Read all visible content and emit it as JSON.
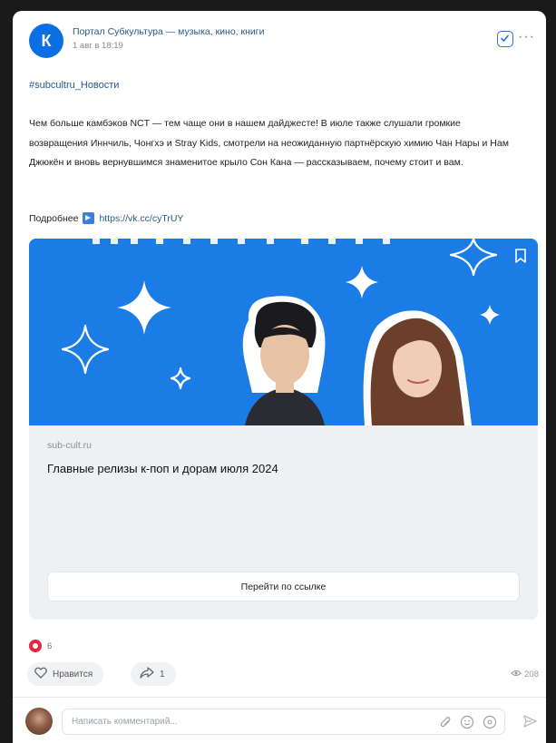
{
  "post": {
    "group_avatar_letter": "К",
    "group_name": "Портал Субкультура — музыка, кино, книги",
    "date": "1 авг в 18:19",
    "hashtag": "#subcultru_Новости",
    "text": "Чем больше камбэков NCT — тем чаще они в нашем дайджесте! В июле также слушали громкие возвращения Иннчиль, Чонгхэ и Stray Kids, смотрели на неожиданную партнёрскую химию Чан Нары и Нам Джюкён и вновь вернувшимся знаменитое крыло Сон Кана — рассказываем, почему стоит и вам.",
    "more_label": "Подробнее",
    "more_link": "https://vk.cc/cyTrUY"
  },
  "snippet": {
    "domain": "sub-cult.ru",
    "title": "Главные релизы к-поп и дорам июля 2024",
    "button_label": "Перейти по ссылке"
  },
  "stats": {
    "reactions_count": "6",
    "like_label": "Нравится",
    "shares_count": "1",
    "views_count": "208"
  },
  "comment": {
    "placeholder": "Написать комментарий..."
  },
  "colors": {
    "accent": "#2a5885",
    "banner_blue": "#1c7ce6",
    "reaction_red": "#e8253b"
  },
  "icons": [
    "check-icon",
    "more-icon",
    "bookmark-icon",
    "heart-icon",
    "share-icon",
    "eye-icon",
    "attach-icon",
    "emoji-icon",
    "info-icon",
    "send-icon"
  ]
}
